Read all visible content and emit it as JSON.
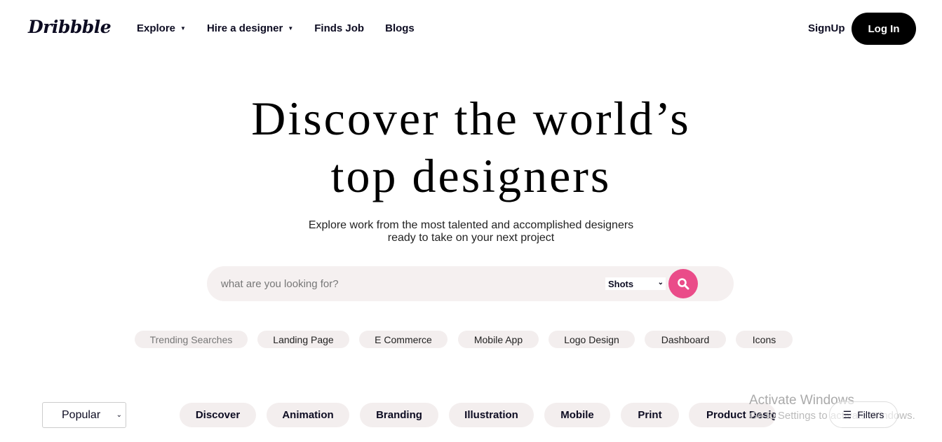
{
  "header": {
    "logo": "Dribbble",
    "nav": [
      {
        "label": "Explore",
        "has_caret": true
      },
      {
        "label": "Hire a designer",
        "has_caret": true
      },
      {
        "label": "Finds Job",
        "has_caret": false
      },
      {
        "label": "Blogs",
        "has_caret": false
      }
    ],
    "signup": "SignUp",
    "login": "Log In"
  },
  "hero": {
    "title_line1": "Discover the world’s",
    "title_line2": "top designers",
    "subtitle_line1": "Explore work from the most talented and accomplished designers",
    "subtitle_line2": "ready to take on your next project"
  },
  "search": {
    "placeholder": "what are you looking for?",
    "type_selected": "Shots",
    "button_icon": "search-icon",
    "button_color": "#ea4c89"
  },
  "trending": {
    "label": "Trending Searches",
    "chips": [
      "Landing Page",
      "E Commerce",
      "Mobile App",
      "Logo Design",
      "Dashboard",
      "Icons"
    ]
  },
  "filter_bar": {
    "sort_selected": "Popular",
    "categories": [
      "Discover",
      "Animation",
      "Branding",
      "Illustration",
      "Mobile",
      "Print",
      "Product Design"
    ],
    "filters_label": "Filters",
    "filters_icon": "menu-icon"
  },
  "os_watermark": {
    "line1": "Activate Windows",
    "line2": "Go to Settings to activate Windows."
  }
}
